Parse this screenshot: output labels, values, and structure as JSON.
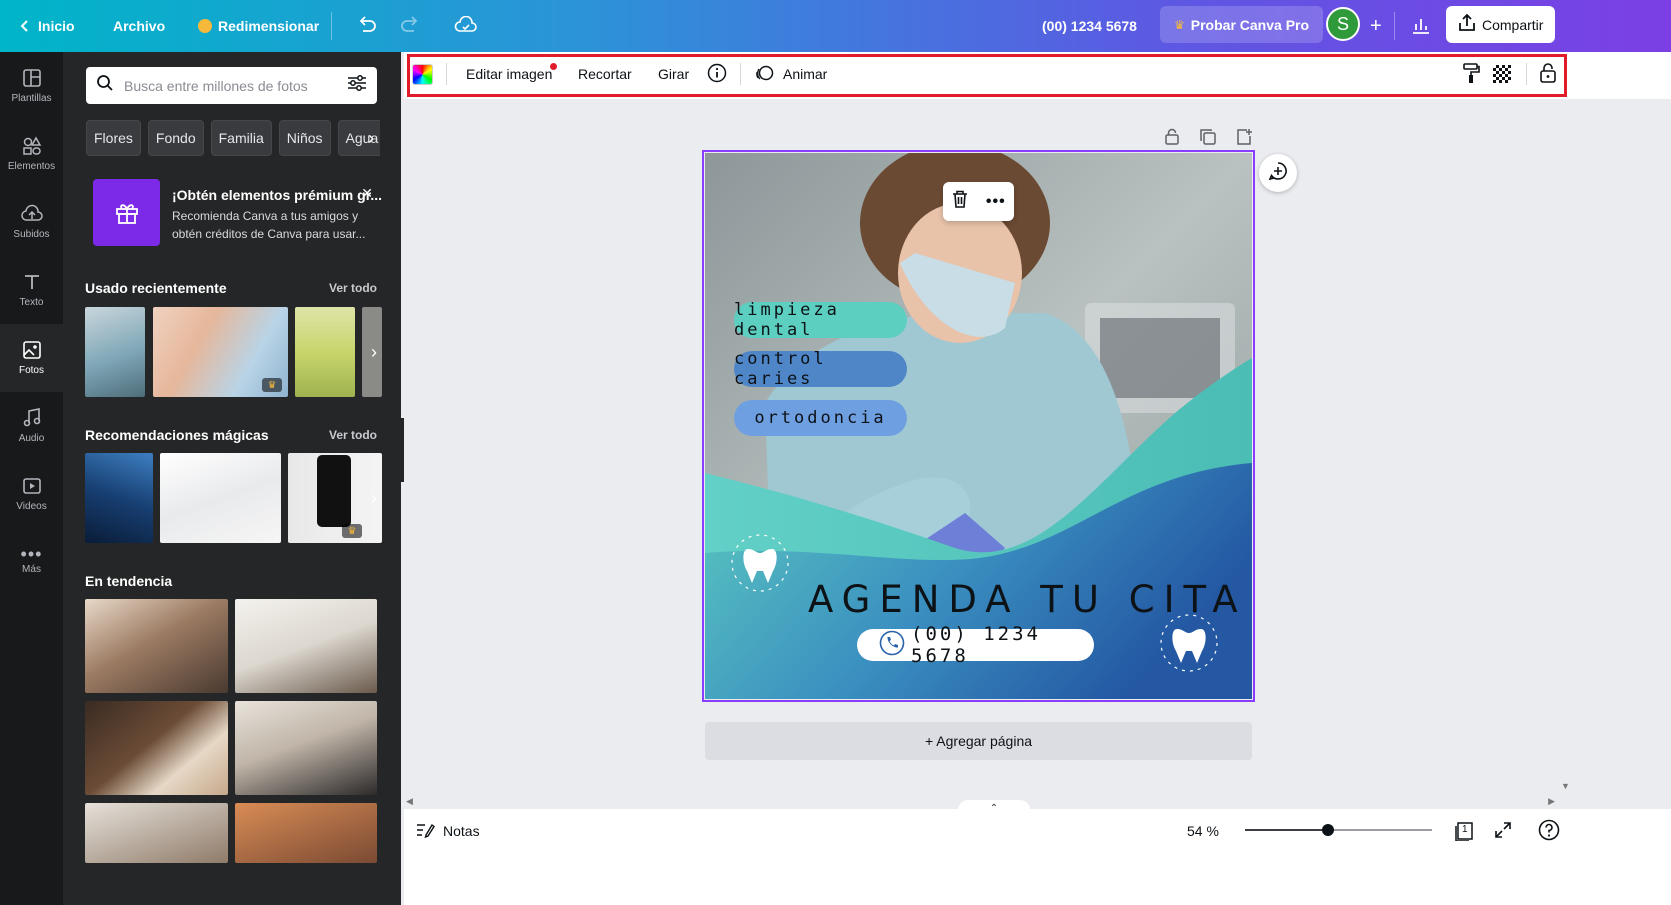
{
  "topbar": {
    "home_label": "Inicio",
    "file_label": "Archivo",
    "resize_label": "Redimensionar",
    "doc_title": "(00) 1234 5678",
    "pro_label": "Probar Canva Pro",
    "avatar_initial": "S",
    "share_label": "Compartir",
    "pro_crown_color": "#f6b93b"
  },
  "rail": {
    "items": [
      {
        "label": "Plantillas",
        "icon": "template-icon"
      },
      {
        "label": "Elementos",
        "icon": "elements-icon"
      },
      {
        "label": "Subidos",
        "icon": "upload-icon"
      },
      {
        "label": "Texto",
        "icon": "text-icon"
      },
      {
        "label": "Fotos",
        "icon": "photo-icon",
        "active": true
      },
      {
        "label": "Audio",
        "icon": "audio-icon"
      },
      {
        "label": "Videos",
        "icon": "video-icon"
      },
      {
        "label": "Más",
        "icon": "more-icon"
      }
    ]
  },
  "panel": {
    "search_placeholder": "Busca entre millones de fotos",
    "chips": [
      "Flores",
      "Fondo",
      "Familia",
      "Niños",
      "Agua"
    ],
    "promo_title": "¡Obtén elementos prémium gr...",
    "promo_text": "Recomienda Canva a tus amigos y obtén créditos de Canva para usar...",
    "recent_title": "Usado recientemente",
    "recent_more": "Ver todo",
    "magic_title": "Recomendaciones mágicas",
    "magic_more": "Ver todo",
    "trending_title": "En tendencia"
  },
  "ctxbar": {
    "edit_image": "Editar imagen",
    "crop": "Recortar",
    "flip": "Girar",
    "animate": "Animar"
  },
  "design": {
    "service_1": "limpieza dental",
    "service_2": "control caries",
    "service_3": "ortodoncia",
    "headline": "AGENDA TU CITA",
    "phone": "(00) 1234 5678",
    "accent_teal": "#4fc4bd",
    "accent_blue": "#2a63a8"
  },
  "canvas": {
    "add_page": "+ Agregar página"
  },
  "bottombar": {
    "notes": "Notas",
    "zoom": "54 %",
    "zoom_level": 0.54,
    "page_count": "1"
  }
}
